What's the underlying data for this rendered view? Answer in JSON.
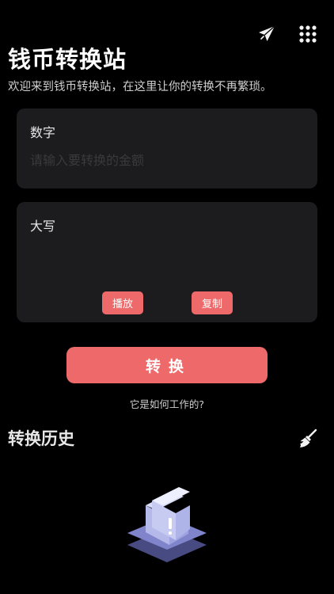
{
  "header": {
    "title": "钱币转换站",
    "subtitle": "欢迎来到钱币转换站，在这里让你的转换不再繁琐。",
    "icons": [
      "paper-plane-icon",
      "grid-menu-icon"
    ]
  },
  "number_card": {
    "label": "数字",
    "input_value": "",
    "input_placeholder": "请输入要转换的金额"
  },
  "uppercase_card": {
    "label": "大写",
    "output_value": "",
    "play_label": "播放",
    "copy_label": "复制"
  },
  "actions": {
    "convert_label": "转换",
    "how_it_works_label": "它是如何工作的?"
  },
  "history": {
    "title": "转换历史",
    "clear_icon": "broom-icon",
    "empty_icon": "empty-folder-icon"
  },
  "colors": {
    "background": "#000000",
    "card": "#1c1b1d",
    "accent": "#ee6a6a",
    "illustration": "#8f94d8"
  }
}
